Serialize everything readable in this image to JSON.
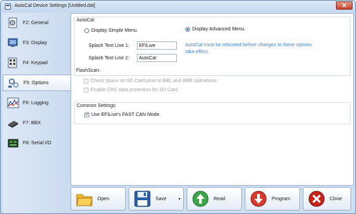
{
  "window": {
    "title": "AutoCal Device Settings [Untitled.dat]",
    "close_glyph": "✕"
  },
  "sidebar": {
    "items": [
      {
        "label": "F2: General",
        "icon": "gear-document-icon"
      },
      {
        "label": "F3: Display",
        "icon": "display-icon"
      },
      {
        "label": "F4: Keypad",
        "icon": "keypad-icon"
      },
      {
        "label": "F5: Options",
        "icon": "options-icon",
        "active": true
      },
      {
        "label": "F6: Logging",
        "icon": "logging-chart-icon"
      },
      {
        "label": "F7: BBX",
        "icon": "bbx-chip-icon"
      },
      {
        "label": "F8: Serial I/O",
        "icon": "serial-board-icon"
      }
    ]
  },
  "autocal": {
    "title": "AutoCal:",
    "simple_menu_label": "Display Simple Menu.",
    "advanced_menu_label": "Display Advanced Menu.",
    "selected_menu": "advanced",
    "splash1_label": "Splash Text Line 1:",
    "splash1_value": "EFILive",
    "splash2_label": "Splash Text Line 2:",
    "splash2_value": "AutoCal",
    "note": "AutoCal must be rebooted before changes to these options take effect."
  },
  "flashscan": {
    "title": "FlashScan:",
    "check_space_label": "Check space on SD Card prior to BBL and BBR operations.",
    "crc_label": "Enable CRC data protection for SD Card."
  },
  "common": {
    "title": "Common Settings:",
    "fast_can_label": "Use EFILive's FAST CAN Mode.",
    "fast_can_checked": true,
    "check_glyph": "✓"
  },
  "toolbar": {
    "open_label": "Open",
    "save_label": "Save",
    "save_arrow": "▾",
    "read_label": "Read",
    "program_label": "Program",
    "close_label": "Close"
  },
  "colors": {
    "open_icon": "#e3a21a",
    "save_icon": "#2b5fa8",
    "read_icon": "#3ea44a",
    "program_icon": "#d63a2f",
    "close_icon": "#c8221c",
    "note_text": "#3f84d0"
  }
}
